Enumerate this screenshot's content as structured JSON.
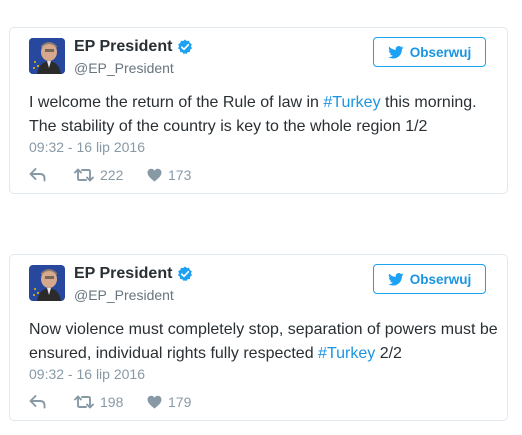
{
  "tweets": [
    {
      "author": {
        "display_name": "EP President",
        "handle": "@EP_President"
      },
      "follow_label": "Obserwuj",
      "text_parts": [
        "I welcome the return of the Rule of law in ",
        "#Turkey",
        " this morning. The stability of the country is key to the whole region 1/2"
      ],
      "timestamp": "09:32 - 16 lip 2016",
      "retweets": "222",
      "likes": "173"
    },
    {
      "author": {
        "display_name": "EP President",
        "handle": "@EP_President"
      },
      "follow_label": "Obserwuj",
      "text_parts": [
        "Now violence must completely stop, separation of powers must be ensured, individual rights fully respected ",
        "#Turkey",
        " 2/2"
      ],
      "timestamp": "09:32 - 16 lip 2016",
      "retweets": "198",
      "likes": "179"
    }
  ],
  "icons": {
    "verified": "verified-badge-icon",
    "follow": "twitter-bird-icon",
    "reply": "reply-icon",
    "retweet": "retweet-icon",
    "like": "heart-icon"
  },
  "colors": {
    "link": "#1b95e0",
    "muted": "#8899a6",
    "border": "#e1e8ed",
    "text": "#292f33"
  }
}
